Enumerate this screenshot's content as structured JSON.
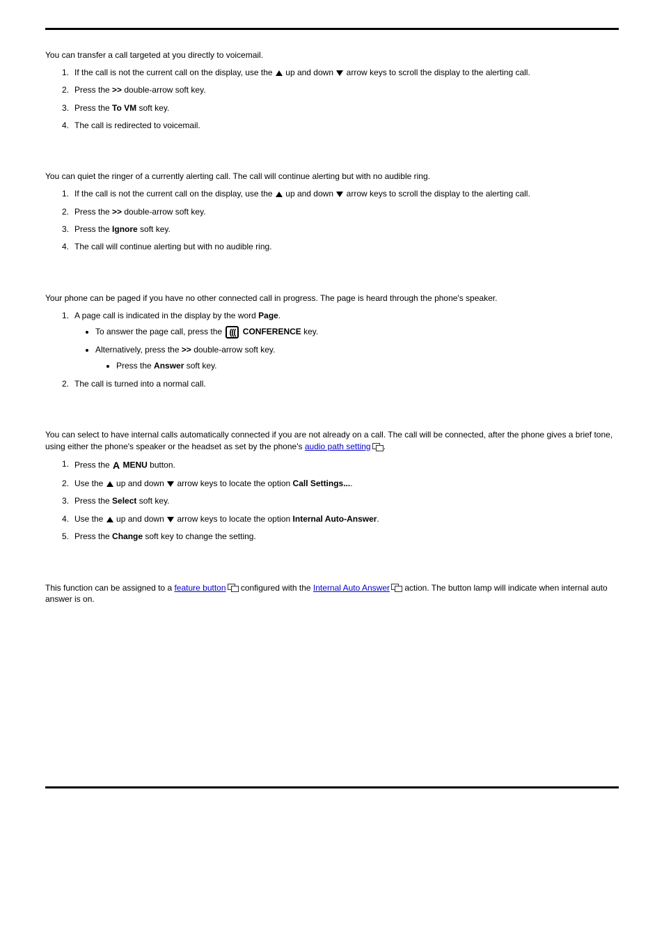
{
  "section1": {
    "intro": "You can transfer a call targeted at you directly to voicemail.",
    "li1_a": "If the call is not the current call on the display, use the ",
    "li1_b": " up and down ",
    "li1_c": " arrow keys to scroll the display to the alerting call.",
    "li2_a": "Press the ",
    "li2_b": ">>",
    "li2_c": " double-arrow soft key.",
    "li3_a": "Press the ",
    "li3_b": "To VM",
    "li3_c": " soft key.",
    "li4": "The call is redirected to voicemail."
  },
  "section2": {
    "intro": "You can quiet the ringer of a currently alerting call. The call will continue alerting but with no audible ring.",
    "li1_a": "If the call is not the current call on the display, use the ",
    "li1_b": " up and down ",
    "li1_c": " arrow keys to scroll the display to the alerting call.",
    "li2_a": "Press the ",
    "li2_b": ">>",
    "li2_c": " double-arrow soft key.",
    "li3_a": "Press the ",
    "li3_b": "Ignore",
    "li3_c": " soft key.",
    "li4": "The call will continue alerting but with no audible ring."
  },
  "section3": {
    "intro": "Your phone can be paged if you have no other connected call in progress. The page is heard through the phone's speaker.",
    "li1_a": "A page call is indicated in the display by the word ",
    "li1_b": "Page",
    "li1_c": ".",
    "sub1_a": "To answer the page call, press the ",
    "sub1_b": " CONFERENCE",
    "sub1_c": " key.",
    "sub2_a": "Alternatively, press the ",
    "sub2_b": ">>",
    "sub2_c": " double-arrow soft key.",
    "sub3_a": "Press the ",
    "sub3_b": "Answer",
    "sub3_c": " soft key.",
    "li2": "The call is turned into a normal call."
  },
  "section4": {
    "intro_a": "You can select to have internal calls automatically connected if you are not already on a call. The call will be connected, after the phone gives a brief tone, using either the phone's speaker or the headset as set by the phone's ",
    "intro_link": "audio path setting",
    "intro_c": ".",
    "li1_a": "Press the ",
    "li1_b": " MENU",
    "li1_c": " button.",
    "li2_a": "Use the ",
    "li2_b": " up and down ",
    "li2_c": " arrow keys to locate the option ",
    "li2_d": "Call Settings...",
    "li2_e": ".",
    "li3_a": "Press the ",
    "li3_b": "Select",
    "li3_c": " soft key.",
    "li4_a": "Use the ",
    "li4_b": " up and down ",
    "li4_c": " arrow keys to locate the option ",
    "li4_d": "Internal Auto-Answer",
    "li4_e": ".",
    "li5_a": "Press the ",
    "li5_b": "Change",
    "li5_c": " soft key to change the setting.",
    "note_a": "This function can be assigned to a ",
    "note_link1": "feature button",
    "note_b": " configured with the ",
    "note_link2": "Internal Auto Answer",
    "note_c": " action. The button lamp will indicate when internal auto answer is on."
  }
}
